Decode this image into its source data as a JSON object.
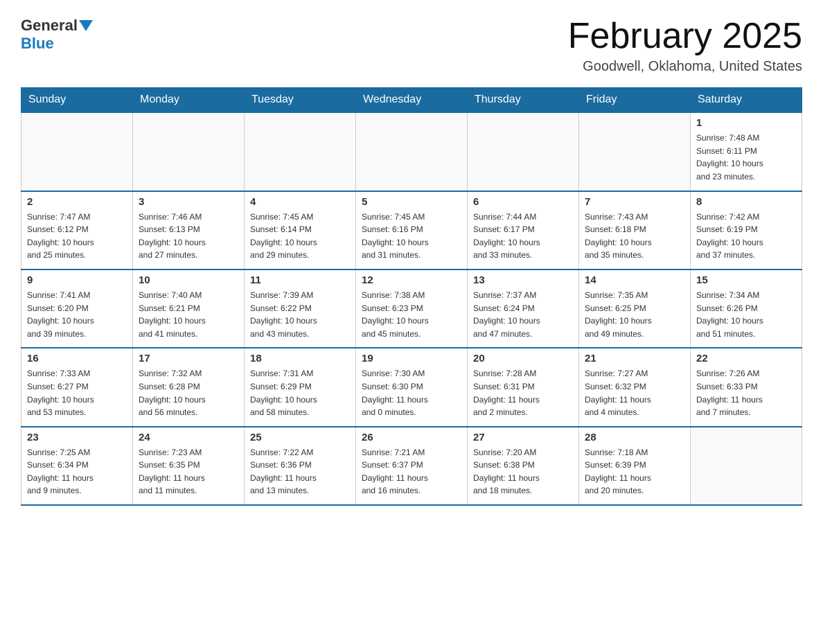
{
  "header": {
    "logo_general": "General",
    "logo_blue": "Blue",
    "month_title": "February 2025",
    "location": "Goodwell, Oklahoma, United States"
  },
  "weekdays": [
    "Sunday",
    "Monday",
    "Tuesday",
    "Wednesday",
    "Thursday",
    "Friday",
    "Saturday"
  ],
  "weeks": [
    [
      {
        "day": "",
        "info": ""
      },
      {
        "day": "",
        "info": ""
      },
      {
        "day": "",
        "info": ""
      },
      {
        "day": "",
        "info": ""
      },
      {
        "day": "",
        "info": ""
      },
      {
        "day": "",
        "info": ""
      },
      {
        "day": "1",
        "info": "Sunrise: 7:48 AM\nSunset: 6:11 PM\nDaylight: 10 hours\nand 23 minutes."
      }
    ],
    [
      {
        "day": "2",
        "info": "Sunrise: 7:47 AM\nSunset: 6:12 PM\nDaylight: 10 hours\nand 25 minutes."
      },
      {
        "day": "3",
        "info": "Sunrise: 7:46 AM\nSunset: 6:13 PM\nDaylight: 10 hours\nand 27 minutes."
      },
      {
        "day": "4",
        "info": "Sunrise: 7:45 AM\nSunset: 6:14 PM\nDaylight: 10 hours\nand 29 minutes."
      },
      {
        "day": "5",
        "info": "Sunrise: 7:45 AM\nSunset: 6:16 PM\nDaylight: 10 hours\nand 31 minutes."
      },
      {
        "day": "6",
        "info": "Sunrise: 7:44 AM\nSunset: 6:17 PM\nDaylight: 10 hours\nand 33 minutes."
      },
      {
        "day": "7",
        "info": "Sunrise: 7:43 AM\nSunset: 6:18 PM\nDaylight: 10 hours\nand 35 minutes."
      },
      {
        "day": "8",
        "info": "Sunrise: 7:42 AM\nSunset: 6:19 PM\nDaylight: 10 hours\nand 37 minutes."
      }
    ],
    [
      {
        "day": "9",
        "info": "Sunrise: 7:41 AM\nSunset: 6:20 PM\nDaylight: 10 hours\nand 39 minutes."
      },
      {
        "day": "10",
        "info": "Sunrise: 7:40 AM\nSunset: 6:21 PM\nDaylight: 10 hours\nand 41 minutes."
      },
      {
        "day": "11",
        "info": "Sunrise: 7:39 AM\nSunset: 6:22 PM\nDaylight: 10 hours\nand 43 minutes."
      },
      {
        "day": "12",
        "info": "Sunrise: 7:38 AM\nSunset: 6:23 PM\nDaylight: 10 hours\nand 45 minutes."
      },
      {
        "day": "13",
        "info": "Sunrise: 7:37 AM\nSunset: 6:24 PM\nDaylight: 10 hours\nand 47 minutes."
      },
      {
        "day": "14",
        "info": "Sunrise: 7:35 AM\nSunset: 6:25 PM\nDaylight: 10 hours\nand 49 minutes."
      },
      {
        "day": "15",
        "info": "Sunrise: 7:34 AM\nSunset: 6:26 PM\nDaylight: 10 hours\nand 51 minutes."
      }
    ],
    [
      {
        "day": "16",
        "info": "Sunrise: 7:33 AM\nSunset: 6:27 PM\nDaylight: 10 hours\nand 53 minutes."
      },
      {
        "day": "17",
        "info": "Sunrise: 7:32 AM\nSunset: 6:28 PM\nDaylight: 10 hours\nand 56 minutes."
      },
      {
        "day": "18",
        "info": "Sunrise: 7:31 AM\nSunset: 6:29 PM\nDaylight: 10 hours\nand 58 minutes."
      },
      {
        "day": "19",
        "info": "Sunrise: 7:30 AM\nSunset: 6:30 PM\nDaylight: 11 hours\nand 0 minutes."
      },
      {
        "day": "20",
        "info": "Sunrise: 7:28 AM\nSunset: 6:31 PM\nDaylight: 11 hours\nand 2 minutes."
      },
      {
        "day": "21",
        "info": "Sunrise: 7:27 AM\nSunset: 6:32 PM\nDaylight: 11 hours\nand 4 minutes."
      },
      {
        "day": "22",
        "info": "Sunrise: 7:26 AM\nSunset: 6:33 PM\nDaylight: 11 hours\nand 7 minutes."
      }
    ],
    [
      {
        "day": "23",
        "info": "Sunrise: 7:25 AM\nSunset: 6:34 PM\nDaylight: 11 hours\nand 9 minutes."
      },
      {
        "day": "24",
        "info": "Sunrise: 7:23 AM\nSunset: 6:35 PM\nDaylight: 11 hours\nand 11 minutes."
      },
      {
        "day": "25",
        "info": "Sunrise: 7:22 AM\nSunset: 6:36 PM\nDaylight: 11 hours\nand 13 minutes."
      },
      {
        "day": "26",
        "info": "Sunrise: 7:21 AM\nSunset: 6:37 PM\nDaylight: 11 hours\nand 16 minutes."
      },
      {
        "day": "27",
        "info": "Sunrise: 7:20 AM\nSunset: 6:38 PM\nDaylight: 11 hours\nand 18 minutes."
      },
      {
        "day": "28",
        "info": "Sunrise: 7:18 AM\nSunset: 6:39 PM\nDaylight: 11 hours\nand 20 minutes."
      },
      {
        "day": "",
        "info": ""
      }
    ]
  ]
}
